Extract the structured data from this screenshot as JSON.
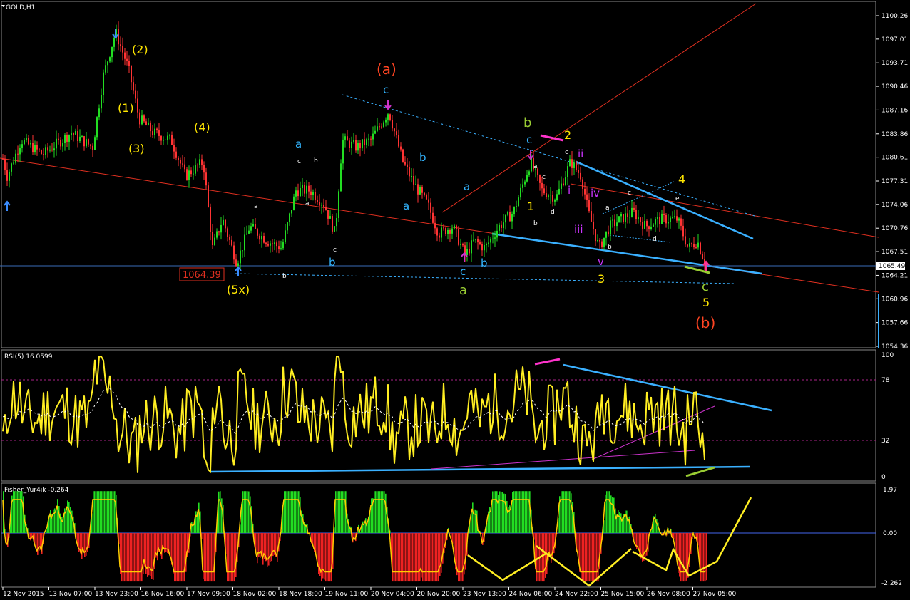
{
  "header": {
    "symbol_title": "GOLD,H1",
    "rsi_title": "RSI(5) 16.0599",
    "fisher_title": "Fisher_Yur4ik -0.264"
  },
  "colors": {
    "background": "#000000",
    "bull_candle": "#22dd22",
    "bear_candle": "#ff3333",
    "trendline_red": "#e03020",
    "trendline_blue": "#3ab0ff",
    "wave_yellow": "#ffe600",
    "wave_cyan": "#33b5ff",
    "wave_orange": "#ff4422",
    "wave_lime": "#99cc33",
    "wave_magenta": "#cc33ff",
    "rsi_line": "#ffee22",
    "fisher_pos": "#22dd22",
    "fisher_neg": "#ee2222",
    "fisher_line": "#ffcc00"
  },
  "chart_data": [
    {
      "type": "candlestick",
      "symbol": "GOLD",
      "timeframe": "H1",
      "ylim": [
        1054.36,
        1102.14
      ],
      "y_ticks": [
        "1100.26",
        "1097.01",
        "1093.71",
        "1090.46",
        "1087.16",
        "1083.86",
        "1080.61",
        "1077.31",
        "1074.06",
        "1070.76",
        "1067.51",
        "1064.21",
        "1060.96",
        "1057.66",
        "1054.36"
      ],
      "current_price": "1065.49",
      "price_marker": "1064.39",
      "x_ticks": [
        "12 Nov 2015",
        "13 Nov 07:00",
        "13 Nov 23:00",
        "16 Nov 16:00",
        "17 Nov 09:00",
        "18 Nov 02:00",
        "18 Nov 18:00",
        "19 Nov 11:00",
        "20 Nov 04:00",
        "20 Nov 20:00",
        "23 Nov 13:00",
        "24 Nov 06:00",
        "24 Nov 22:00",
        "25 Nov 15:00",
        "26 Nov 08:00",
        "27 Nov 05:00"
      ],
      "key_closes": [
        {
          "x": 0,
          "price": 1082
        },
        {
          "x": 10,
          "price": 1078
        },
        {
          "x": 30,
          "price": 1083
        },
        {
          "x": 60,
          "price": 1081
        },
        {
          "x": 100,
          "price": 1084
        },
        {
          "x": 130,
          "price": 1082
        },
        {
          "x": 145,
          "price": 1092
        },
        {
          "x": 162,
          "price": 1098
        },
        {
          "x": 180,
          "price": 1093
        },
        {
          "x": 195,
          "price": 1086
        },
        {
          "x": 215,
          "price": 1084
        },
        {
          "x": 240,
          "price": 1083
        },
        {
          "x": 260,
          "price": 1078
        },
        {
          "x": 285,
          "price": 1080
        },
        {
          "x": 298,
          "price": 1068
        },
        {
          "x": 312,
          "price": 1072
        },
        {
          "x": 332,
          "price": 1066
        },
        {
          "x": 350,
          "price": 1071
        },
        {
          "x": 375,
          "price": 1069
        },
        {
          "x": 395,
          "price": 1068
        },
        {
          "x": 415,
          "price": 1076
        },
        {
          "x": 435,
          "price": 1076
        },
        {
          "x": 455,
          "price": 1074
        },
        {
          "x": 470,
          "price": 1070
        },
        {
          "x": 480,
          "price": 1083
        },
        {
          "x": 500,
          "price": 1082
        },
        {
          "x": 520,
          "price": 1083
        },
        {
          "x": 545,
          "price": 1087
        },
        {
          "x": 565,
          "price": 1080
        },
        {
          "x": 580,
          "price": 1077
        },
        {
          "x": 600,
          "price": 1074
        },
        {
          "x": 615,
          "price": 1070
        },
        {
          "x": 635,
          "price": 1071
        },
        {
          "x": 652,
          "price": 1067
        },
        {
          "x": 665,
          "price": 1069
        },
        {
          "x": 680,
          "price": 1068
        },
        {
          "x": 700,
          "price": 1071
        },
        {
          "x": 720,
          "price": 1073
        },
        {
          "x": 744,
          "price": 1080
        },
        {
          "x": 760,
          "price": 1076
        },
        {
          "x": 780,
          "price": 1075
        },
        {
          "x": 800,
          "price": 1080
        },
        {
          "x": 815,
          "price": 1078
        },
        {
          "x": 825,
          "price": 1073
        },
        {
          "x": 840,
          "price": 1068
        },
        {
          "x": 855,
          "price": 1071
        },
        {
          "x": 870,
          "price": 1072
        },
        {
          "x": 888,
          "price": 1073
        },
        {
          "x": 905,
          "price": 1071
        },
        {
          "x": 925,
          "price": 1072
        },
        {
          "x": 950,
          "price": 1072
        },
        {
          "x": 965,
          "price": 1068
        },
        {
          "x": 978,
          "price": 1069
        },
        {
          "x": 990,
          "price": 1065.5
        }
      ]
    },
    {
      "type": "line",
      "name": "RSI(5)",
      "value": "16.0599",
      "ylim": [
        0,
        100
      ],
      "y_ticks": [
        "100",
        "78",
        "32",
        "0"
      ],
      "levels": [
        78,
        32
      ]
    },
    {
      "type": "histogram",
      "name": "Fisher_Yur4ik",
      "value": "-0.264",
      "y_ticks": [
        "1.97",
        "0.00",
        "-2.262"
      ]
    }
  ],
  "wave_labels": [
    {
      "text": "(2)",
      "color": "#ffe600"
    },
    {
      "text": "(1)",
      "color": "#ffe600"
    },
    {
      "text": "(3)",
      "color": "#ffe600"
    },
    {
      "text": "(4)",
      "color": "#ffe600"
    },
    {
      "text": "(5x)",
      "color": "#ffe600"
    },
    {
      "text": "(a)",
      "color": "#ff4422"
    },
    {
      "text": "(b)",
      "color": "#ff4422"
    },
    {
      "text": "b",
      "color": "#99cc33"
    },
    {
      "text": "a",
      "color": "#99cc33"
    },
    {
      "text": "c",
      "color": "#99cc33"
    },
    {
      "text": "2",
      "color": "#ffe600"
    },
    {
      "text": "1",
      "color": "#ffe600"
    },
    {
      "text": "3",
      "color": "#ffe600"
    },
    {
      "text": "4",
      "color": "#ffe600"
    },
    {
      "text": "5",
      "color": "#ffe600"
    },
    {
      "text": "i",
      "color": "#cc33ff"
    },
    {
      "text": "ii",
      "color": "#cc33ff"
    },
    {
      "text": "iii",
      "color": "#cc33ff"
    },
    {
      "text": "iv",
      "color": "#cc33ff"
    },
    {
      "text": "v",
      "color": "#cc33ff"
    }
  ]
}
